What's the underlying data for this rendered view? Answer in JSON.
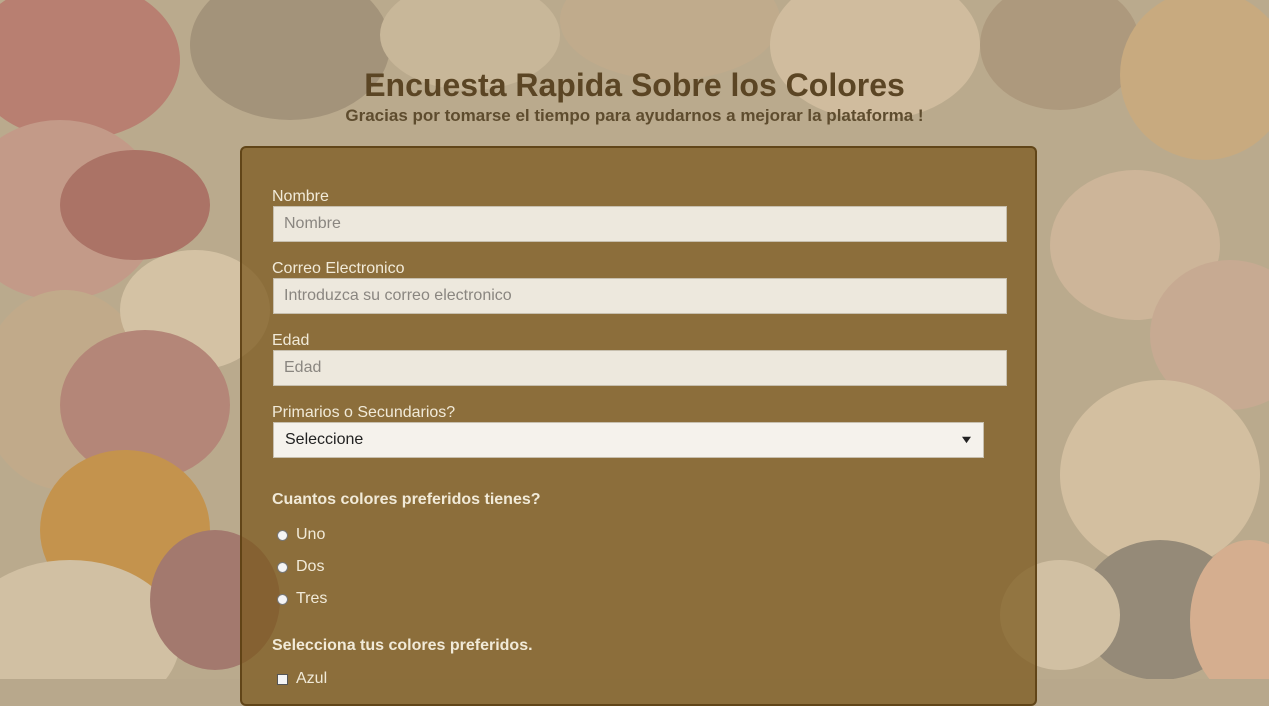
{
  "page": {
    "title": "Encuesta Rapida Sobre los Colores",
    "subtitle": "Gracias por tomarse el tiempo para ayudarnos a mejorar la plataforma !"
  },
  "form": {
    "name": {
      "label": "Nombre",
      "placeholder": "Nombre",
      "value": ""
    },
    "email": {
      "label": "Correo Electronico",
      "placeholder": "Introduzca su correo electronico",
      "value": ""
    },
    "age": {
      "label": "Edad",
      "placeholder": "Edad",
      "value": ""
    },
    "type": {
      "label": "Primarios o Secundarios?",
      "selected": "Seleccione"
    },
    "count_question": "Cuantos colores preferidos tienes?",
    "count_options": [
      {
        "label": "Uno",
        "checked": false
      },
      {
        "label": "Dos",
        "checked": false
      },
      {
        "label": "Tres",
        "checked": false
      }
    ],
    "colors_question": "Selecciona tus colores preferidos.",
    "color_options": [
      {
        "label": "Azul",
        "checked": false
      }
    ]
  },
  "colors": {
    "title": "#5b4524",
    "panel": "#7a581c",
    "label_text": "#f1ead8"
  }
}
